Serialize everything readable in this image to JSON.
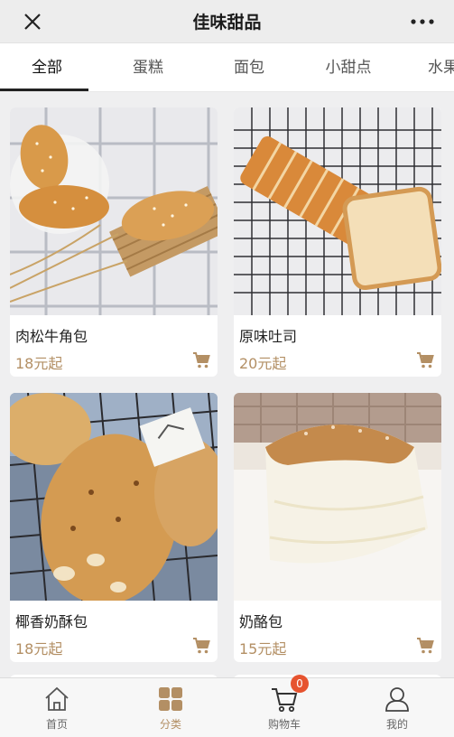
{
  "header": {
    "title": "佳味甜品"
  },
  "tabs": [
    {
      "label": "全部",
      "active": true
    },
    {
      "label": "蛋糕",
      "active": false
    },
    {
      "label": "面包",
      "active": false
    },
    {
      "label": "小甜点",
      "active": false
    },
    {
      "label": "水果",
      "active": false
    }
  ],
  "products": [
    {
      "name": "肉松牛角包",
      "price": "18元起",
      "image": "croissant-buns-photo"
    },
    {
      "name": "原味吐司",
      "price": "20元起",
      "image": "sliced-toast-photo"
    },
    {
      "name": "椰香奶酥包",
      "price": "18元起",
      "image": "coconut-bread-photo"
    },
    {
      "name": "奶酪包",
      "price": "15元起",
      "image": "cheese-bread-photo"
    }
  ],
  "bottom_nav": [
    {
      "label": "首页",
      "icon": "home-icon",
      "active": false
    },
    {
      "label": "分类",
      "icon": "category-grid-icon",
      "active": true
    },
    {
      "label": "购物车",
      "icon": "cart-icon",
      "active": false,
      "badge": "0"
    },
    {
      "label": "我的",
      "icon": "user-icon",
      "active": false
    }
  ],
  "colors": {
    "accent": "#b38f64",
    "badge": "#e6532f",
    "header_bg": "#ededed",
    "page_bg": "#efeff0"
  }
}
